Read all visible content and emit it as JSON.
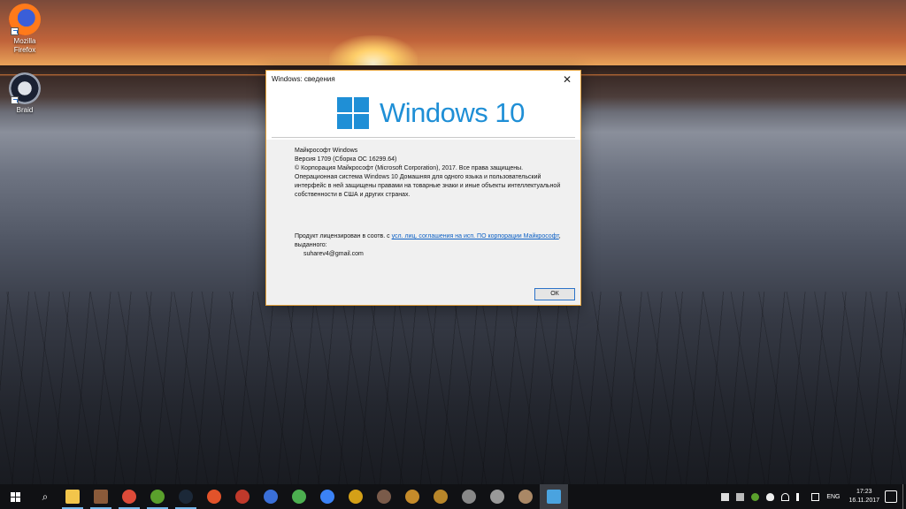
{
  "desktop": {
    "icons": [
      {
        "label_line1": "Mozilla",
        "label_line2": "Firefox",
        "icon": "firefox-icon"
      },
      {
        "label_line1": "Braid",
        "icon": "braid-icon"
      }
    ]
  },
  "dialog": {
    "title": "Windows: сведения",
    "close_glyph": "✕",
    "logo_text": "Windows 10",
    "info": {
      "line1": "Майкрософт Windows",
      "line2": "Версия 1709 (Сборка ОС 16299.64)",
      "line3": "© Корпорация Майкрософт (Microsoft Corporation), 2017. Все права защищены.",
      "line4": "Операционная система Windows 10 Домашняя для одного языка и пользовательский интерфейс в ней защищены правами на товарные знаки и иные объекты интеллектуальной собственности в США и других странах."
    },
    "license": {
      "prefix": "Продукт лицензирован в соотв. с ",
      "link": "усл. лиц. соглашения на исп. ПО корпорации Майкрософт",
      "suffix": ", выданного:"
    },
    "email": "suharev4@gmail.com",
    "ok_label": "ОК"
  },
  "taskbar": {
    "search_glyph": "⌕",
    "apps": [
      {
        "name": "file-explorer",
        "color": "#f2c54b"
      },
      {
        "name": "app-2",
        "color": "#8a5a3a"
      },
      {
        "name": "chrome",
        "color": "#dd4b39"
      },
      {
        "name": "utorrent",
        "color": "#5aa02c"
      },
      {
        "name": "steam",
        "color": "#1b2838"
      },
      {
        "name": "app-6",
        "color": "#e2532a"
      },
      {
        "name": "app-7",
        "color": "#c0392b"
      },
      {
        "name": "app-8",
        "color": "#3a6fd8"
      },
      {
        "name": "app-9",
        "color": "#4caf50"
      },
      {
        "name": "app-10",
        "color": "#3b82f6"
      },
      {
        "name": "app-11",
        "color": "#d4a017"
      },
      {
        "name": "app-12",
        "color": "#7a5b4a"
      },
      {
        "name": "app-13",
        "color": "#c58b2a"
      },
      {
        "name": "app-14",
        "color": "#b8862a"
      },
      {
        "name": "app-15",
        "color": "#888888"
      },
      {
        "name": "app-16",
        "color": "#999999"
      },
      {
        "name": "app-17",
        "color": "#aa8866"
      },
      {
        "name": "windows-about",
        "color": "#4aa3df"
      }
    ],
    "tray": {
      "language": "ENG",
      "time": "17:23",
      "date": "16.11.2017"
    }
  }
}
